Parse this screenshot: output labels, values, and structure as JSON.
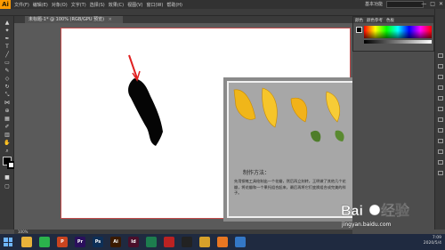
{
  "app": {
    "logo": "Ai"
  },
  "menu": [
    "文件(F)",
    "编辑(E)",
    "对象(O)",
    "文字(T)",
    "选择(S)",
    "效果(C)",
    "视图(V)",
    "窗口(W)",
    "帮助(H)"
  ],
  "header": {
    "workspace": "基本功能",
    "window_controls": [
      "—",
      "□",
      "✕"
    ]
  },
  "document_tab": {
    "title": "未标题-1* @ 100% (RGB/GPU 预览)",
    "close": "×"
  },
  "artwork": {
    "method_title": "制作方法：",
    "method_text": "先用钢笔工具绘制出一个花瓣，然后再立刻转，王明做了其他几个花瓣，将花瓣和一个果托组合起来，最后再将它们变换组合成完美的样子。"
  },
  "color_panel": {
    "tabs": [
      "颜色",
      "颜色参考",
      "色板"
    ]
  },
  "statusbar": {
    "zoom": "100%"
  },
  "taskbar": {
    "apps": [
      {
        "name": "explorer-icon",
        "color": "#e8b23a",
        "label": ""
      },
      {
        "name": "wechat-icon",
        "color": "#2bb24c",
        "label": ""
      },
      {
        "name": "powerpoint-icon",
        "color": "#c9441f",
        "label": "P"
      },
      {
        "name": "premiere-icon",
        "color": "#2a0f5c",
        "label": "Pr"
      },
      {
        "name": "photoshop-icon",
        "color": "#0d2f57",
        "label": "Ps"
      },
      {
        "name": "illustrator-icon",
        "color": "#3a1a00",
        "label": "Ai"
      },
      {
        "name": "indesign-icon",
        "color": "#4a0f2a",
        "label": "Id"
      },
      {
        "name": "media-icon",
        "color": "#1d7d4e",
        "label": ""
      },
      {
        "name": "player-icon",
        "color": "#b22",
        "label": ""
      },
      {
        "name": "qq-icon",
        "color": "#222",
        "label": ""
      },
      {
        "name": "chrome-icon",
        "color": "#d6a12a",
        "label": ""
      },
      {
        "name": "fox-icon",
        "color": "#e87722",
        "label": ""
      },
      {
        "name": "camera-icon",
        "color": "#3478c6",
        "label": ""
      }
    ],
    "time": "7:09",
    "date": "2020/5/4"
  },
  "watermark": {
    "brand": "Baidu 经验",
    "url": "jingyan.baidu.com"
  }
}
